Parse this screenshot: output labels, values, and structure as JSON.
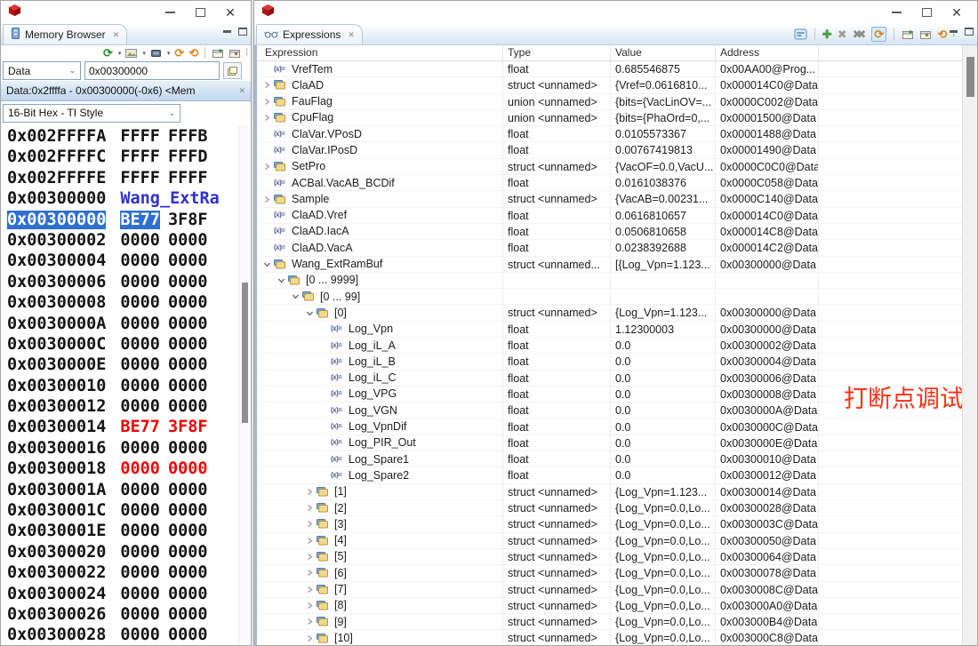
{
  "colors": {
    "selection_blue": "#2e6fd0",
    "memory_label_blue": "#3030d0",
    "memory_changed_red": "#ee0000",
    "annotation_red": "#ff3118"
  },
  "icons": {
    "combo_chevron": "⌄",
    "dropdown_arrow": "▾",
    "refresh_glyph": "⟳",
    "refresh_alt_glyph": "⟲",
    "add_glyph": "✚",
    "remove_glyph": "✖",
    "overflow_glyph": "⁞",
    "close_glyph": "✕",
    "minimize_glyph": "–",
    "var_glyph": "(x)="
  },
  "left_window": {
    "tab_label": "Memory Browser",
    "space_select": "Data",
    "address_input": "0x00300000",
    "memory_tab_label": "Data:0x2ffffa - 0x00300000(-0x6) <Mem",
    "format_select": "16-Bit Hex - TI Style",
    "memory_rows": [
      {
        "addr": "0x002FFFFA",
        "v1": "FFFF",
        "v2": "FFFB",
        "style": "normal"
      },
      {
        "addr": "0x002FFFFC",
        "v1": "FFFF",
        "v2": "FFFD",
        "style": "normal"
      },
      {
        "addr": "0x002FFFFE",
        "v1": "FFFF",
        "v2": "FFFF",
        "style": "normal"
      },
      {
        "addr": "0x00300000",
        "v1": "Wang_ExtRa",
        "v2": "",
        "style": "label"
      },
      {
        "addr": "0x00300000",
        "v1": "BE77",
        "v2": "3F8F",
        "style": "selected"
      },
      {
        "addr": "0x00300002",
        "v1": "0000",
        "v2": "0000",
        "style": "normal"
      },
      {
        "addr": "0x00300004",
        "v1": "0000",
        "v2": "0000",
        "style": "normal"
      },
      {
        "addr": "0x00300006",
        "v1": "0000",
        "v2": "0000",
        "style": "normal"
      },
      {
        "addr": "0x00300008",
        "v1": "0000",
        "v2": "0000",
        "style": "normal"
      },
      {
        "addr": "0x0030000A",
        "v1": "0000",
        "v2": "0000",
        "style": "normal"
      },
      {
        "addr": "0x0030000C",
        "v1": "0000",
        "v2": "0000",
        "style": "normal"
      },
      {
        "addr": "0x0030000E",
        "v1": "0000",
        "v2": "0000",
        "style": "normal"
      },
      {
        "addr": "0x00300010",
        "v1": "0000",
        "v2": "0000",
        "style": "normal"
      },
      {
        "addr": "0x00300012",
        "v1": "0000",
        "v2": "0000",
        "style": "normal"
      },
      {
        "addr": "0x00300014",
        "v1": "BE77",
        "v2": "3F8F",
        "style": "red"
      },
      {
        "addr": "0x00300016",
        "v1": "0000",
        "v2": "0000",
        "style": "normal"
      },
      {
        "addr": "0x00300018",
        "v1": "0000",
        "v2": "0000",
        "style": "red"
      },
      {
        "addr": "0x0030001A",
        "v1": "0000",
        "v2": "0000",
        "style": "normal"
      },
      {
        "addr": "0x0030001C",
        "v1": "0000",
        "v2": "0000",
        "style": "normal"
      },
      {
        "addr": "0x0030001E",
        "v1": "0000",
        "v2": "0000",
        "style": "normal"
      },
      {
        "addr": "0x00300020",
        "v1": "0000",
        "v2": "0000",
        "style": "normal"
      },
      {
        "addr": "0x00300022",
        "v1": "0000",
        "v2": "0000",
        "style": "normal"
      },
      {
        "addr": "0x00300024",
        "v1": "0000",
        "v2": "0000",
        "style": "normal"
      },
      {
        "addr": "0x00300026",
        "v1": "0000",
        "v2": "0000",
        "style": "normal"
      },
      {
        "addr": "0x00300028",
        "v1": "0000",
        "v2": "0000",
        "style": "normal"
      }
    ]
  },
  "right_window": {
    "tab_label": "Expressions",
    "columns": [
      "Expression",
      "Type",
      "Value",
      "Address"
    ],
    "annotation": "打断点调试",
    "rows": [
      {
        "level": 0,
        "arrow": "none",
        "icon": "var",
        "name": "VrefTem",
        "type": "float",
        "value": "0.685546875",
        "address": "0x00AA00@Prog..."
      },
      {
        "level": 0,
        "arrow": "collapsed",
        "icon": "struct",
        "name": "ClaAD",
        "type": "struct <unnamed>",
        "value": "{Vref=0.0616810...",
        "address": "0x000014C0@Data"
      },
      {
        "level": 0,
        "arrow": "collapsed",
        "icon": "struct",
        "name": "FauFlag",
        "type": "union <unnamed>",
        "value": "{bits={VacLinOV=...",
        "address": "0x0000C002@Data"
      },
      {
        "level": 0,
        "arrow": "collapsed",
        "icon": "struct",
        "name": "CpuFlag",
        "type": "union <unnamed>",
        "value": "{bits={PhaOrd=0,...",
        "address": "0x00001500@Data"
      },
      {
        "level": 0,
        "arrow": "none",
        "icon": "var",
        "name": "ClaVar.VPosD",
        "type": "float",
        "value": "0.0105573367",
        "address": "0x00001488@Data"
      },
      {
        "level": 0,
        "arrow": "none",
        "icon": "var",
        "name": "ClaVar.IPosD",
        "type": "float",
        "value": "0.00767419813",
        "address": "0x00001490@Data"
      },
      {
        "level": 0,
        "arrow": "collapsed",
        "icon": "struct",
        "name": "SetPro",
        "type": "struct <unnamed>",
        "value": "{VacOF=0.0,VacU...",
        "address": "0x0000C0C0@Data"
      },
      {
        "level": 0,
        "arrow": "none",
        "icon": "var",
        "name": "ACBal.VacAB_BCDif",
        "type": "float",
        "value": "0.0161038376",
        "address": "0x0000C058@Data"
      },
      {
        "level": 0,
        "arrow": "collapsed",
        "icon": "struct",
        "name": "Sample",
        "type": "struct <unnamed>",
        "value": "{VacAB=0.00231...",
        "address": "0x0000C140@Data"
      },
      {
        "level": 0,
        "arrow": "none",
        "icon": "var",
        "name": "ClaAD.Vref",
        "type": "float",
        "value": "0.0616810657",
        "address": "0x000014C0@Data"
      },
      {
        "level": 0,
        "arrow": "none",
        "icon": "var",
        "name": "ClaAD.IacA",
        "type": "float",
        "value": "0.0506810658",
        "address": "0x000014C8@Data"
      },
      {
        "level": 0,
        "arrow": "none",
        "icon": "var",
        "name": "ClaAD.VacA",
        "type": "float",
        "value": "0.0238392688",
        "address": "0x000014C2@Data"
      },
      {
        "level": 0,
        "arrow": "expanded",
        "icon": "struct",
        "name": "Wang_ExtRamBuf",
        "type": "struct <unnamed...",
        "value": "[{Log_Vpn=1.123...",
        "address": "0x00300000@Data"
      },
      {
        "level": 1,
        "arrow": "expanded",
        "icon": "struct",
        "name": "[0 ... 9999]",
        "type": "",
        "value": "",
        "address": ""
      },
      {
        "level": 2,
        "arrow": "expanded",
        "icon": "struct",
        "name": "[0 ... 99]",
        "type": "",
        "value": "",
        "address": ""
      },
      {
        "level": 3,
        "arrow": "expanded",
        "icon": "struct",
        "name": "[0]",
        "type": "struct <unnamed>",
        "value": "{Log_Vpn=1.123...",
        "address": "0x00300000@Data"
      },
      {
        "level": 4,
        "arrow": "none",
        "icon": "var",
        "name": "Log_Vpn",
        "type": "float",
        "value": "1.12300003",
        "address": "0x00300000@Data"
      },
      {
        "level": 4,
        "arrow": "none",
        "icon": "var",
        "name": "Log_iL_A",
        "type": "float",
        "value": "0.0",
        "address": "0x00300002@Data"
      },
      {
        "level": 4,
        "arrow": "none",
        "icon": "var",
        "name": "Log_iL_B",
        "type": "float",
        "value": "0.0",
        "address": "0x00300004@Data"
      },
      {
        "level": 4,
        "arrow": "none",
        "icon": "var",
        "name": "Log_iL_C",
        "type": "float",
        "value": "0.0",
        "address": "0x00300006@Data"
      },
      {
        "level": 4,
        "arrow": "none",
        "icon": "var",
        "name": "Log_VPG",
        "type": "float",
        "value": "0.0",
        "address": "0x00300008@Data"
      },
      {
        "level": 4,
        "arrow": "none",
        "icon": "var",
        "name": "Log_VGN",
        "type": "float",
        "value": "0.0",
        "address": "0x0030000A@Data"
      },
      {
        "level": 4,
        "arrow": "none",
        "icon": "var",
        "name": "Log_VpnDif",
        "type": "float",
        "value": "0.0",
        "address": "0x0030000C@Data"
      },
      {
        "level": 4,
        "arrow": "none",
        "icon": "var",
        "name": "Log_PIR_Out",
        "type": "float",
        "value": "0.0",
        "address": "0x0030000E@Data"
      },
      {
        "level": 4,
        "arrow": "none",
        "icon": "var",
        "name": "Log_Spare1",
        "type": "float",
        "value": "0.0",
        "address": "0x00300010@Data"
      },
      {
        "level": 4,
        "arrow": "none",
        "icon": "var",
        "name": "Log_Spare2",
        "type": "float",
        "value": "0.0",
        "address": "0x00300012@Data"
      },
      {
        "level": 3,
        "arrow": "collapsed",
        "icon": "struct",
        "name": "[1]",
        "type": "struct <unnamed>",
        "value": "{Log_Vpn=1.123...",
        "address": "0x00300014@Data"
      },
      {
        "level": 3,
        "arrow": "collapsed",
        "icon": "struct",
        "name": "[2]",
        "type": "struct <unnamed>",
        "value": "{Log_Vpn=0.0,Lo...",
        "address": "0x00300028@Data"
      },
      {
        "level": 3,
        "arrow": "collapsed",
        "icon": "struct",
        "name": "[3]",
        "type": "struct <unnamed>",
        "value": "{Log_Vpn=0.0,Lo...",
        "address": "0x0030003C@Data"
      },
      {
        "level": 3,
        "arrow": "collapsed",
        "icon": "struct",
        "name": "[4]",
        "type": "struct <unnamed>",
        "value": "{Log_Vpn=0.0,Lo...",
        "address": "0x00300050@Data"
      },
      {
        "level": 3,
        "arrow": "collapsed",
        "icon": "struct",
        "name": "[5]",
        "type": "struct <unnamed>",
        "value": "{Log_Vpn=0.0,Lo...",
        "address": "0x00300064@Data"
      },
      {
        "level": 3,
        "arrow": "collapsed",
        "icon": "struct",
        "name": "[6]",
        "type": "struct <unnamed>",
        "value": "{Log_Vpn=0.0,Lo...",
        "address": "0x00300078@Data"
      },
      {
        "level": 3,
        "arrow": "collapsed",
        "icon": "struct",
        "name": "[7]",
        "type": "struct <unnamed>",
        "value": "{Log_Vpn=0.0,Lo...",
        "address": "0x0030008C@Data"
      },
      {
        "level": 3,
        "arrow": "collapsed",
        "icon": "struct",
        "name": "[8]",
        "type": "struct <unnamed>",
        "value": "{Log_Vpn=0.0,Lo...",
        "address": "0x003000A0@Data"
      },
      {
        "level": 3,
        "arrow": "collapsed",
        "icon": "struct",
        "name": "[9]",
        "type": "struct <unnamed>",
        "value": "{Log_Vpn=0.0,Lo...",
        "address": "0x003000B4@Data"
      },
      {
        "level": 3,
        "arrow": "collapsed",
        "icon": "struct",
        "name": "[10]",
        "type": "struct <unnamed>",
        "value": "{Log_Vpn=0.0,Lo...",
        "address": "0x003000C8@Data"
      }
    ]
  }
}
